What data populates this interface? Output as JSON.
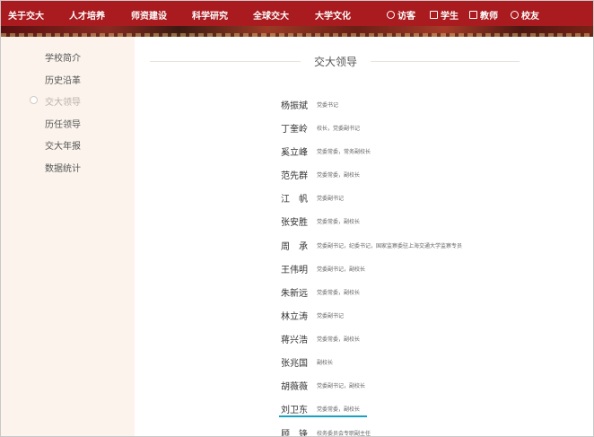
{
  "nav": {
    "items": [
      "关于交大",
      "人才培养",
      "师资建设",
      "科学研究",
      "全球交大",
      "大学文化"
    ],
    "quick": [
      {
        "label": "访客",
        "icon": "visitor-icon"
      },
      {
        "label": "学生",
        "icon": "student-icon"
      },
      {
        "label": "教师",
        "icon": "teacher-icon"
      },
      {
        "label": "校友",
        "icon": "alumni-icon"
      }
    ]
  },
  "sidebar": {
    "items": [
      {
        "label": "学校简介"
      },
      {
        "label": "历史沿革"
      },
      {
        "label": "交大领导",
        "active": true
      },
      {
        "label": "历任领导"
      },
      {
        "label": "交大年报"
      },
      {
        "label": "数据统计"
      }
    ]
  },
  "page": {
    "title": "交大领导"
  },
  "leaders": [
    {
      "name": "杨振斌",
      "title": "党委书记"
    },
    {
      "name": "丁奎岭",
      "title": "校长，党委副书记"
    },
    {
      "name": "奚立峰",
      "title": "党委常委，常务副校长"
    },
    {
      "name": "范先群",
      "title": "党委常委，副校长"
    },
    {
      "name": "江　帆",
      "title": "党委副书记"
    },
    {
      "name": "张安胜",
      "title": "党委常委，副校长"
    },
    {
      "name": "周　承",
      "title": "党委副书记，纪委书记，国家监察委驻上海交通大学监察专员"
    },
    {
      "name": "王伟明",
      "title": "党委副书记，副校长"
    },
    {
      "name": "朱新远",
      "title": "党委常委，副校长"
    },
    {
      "name": "林立涛",
      "title": "党委副书记"
    },
    {
      "name": "蒋兴浩",
      "title": "党委常委，副校长"
    },
    {
      "name": "张兆国",
      "title": "副校长"
    },
    {
      "name": "胡薇薇",
      "title": "党委副书记，副校长"
    },
    {
      "name": "刘卫东",
      "title": "党委常委，副校长"
    },
    {
      "name": "顾　锋",
      "title": "校务委员会专职副主任"
    }
  ],
  "colors": {
    "nav_bg": "#a91b1f",
    "sidebar_bg": "#fbf3ec",
    "highlight": "#1aa1bf"
  }
}
